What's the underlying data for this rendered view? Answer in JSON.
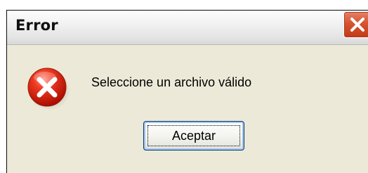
{
  "window": {
    "title": "Error",
    "close_icon": "close-icon"
  },
  "dialog": {
    "icon": "error-icon",
    "message": "Seleccione un archivo válido",
    "ok_label": "Aceptar"
  },
  "colors": {
    "frame": "#ece9d8",
    "close_button": "#d5542f",
    "error_icon": "#d81e05",
    "button_border": "#003c74"
  }
}
